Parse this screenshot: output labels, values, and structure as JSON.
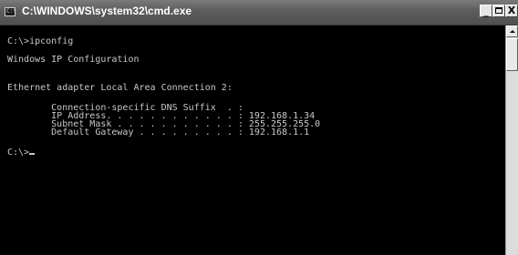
{
  "window": {
    "title": "C:\\WINDOWS\\system32\\cmd.exe",
    "icon": "cmd-icon",
    "icon_glyph": "C:\\",
    "minimize_label": "_",
    "close_label": "X"
  },
  "console": {
    "lines": [
      "C:\\>ipconfig",
      "Windows IP Configuration",
      "Ethernet adapter Local Area Connection 2:",
      "        Connection-specific DNS Suffix  . :",
      "        IP Address. . . . . . . . . . . . : 192.168.1.34",
      "        Subnet Mask . . . . . . . . . . . : 255.255.255.0",
      "        Default Gateway . . . . . . . . . : 192.168.1.1",
      "C:\\>"
    ]
  },
  "colors": {
    "console_background": "#000000",
    "console_text": "#c8c8c8",
    "titlebar": "#5c5c5c"
  }
}
